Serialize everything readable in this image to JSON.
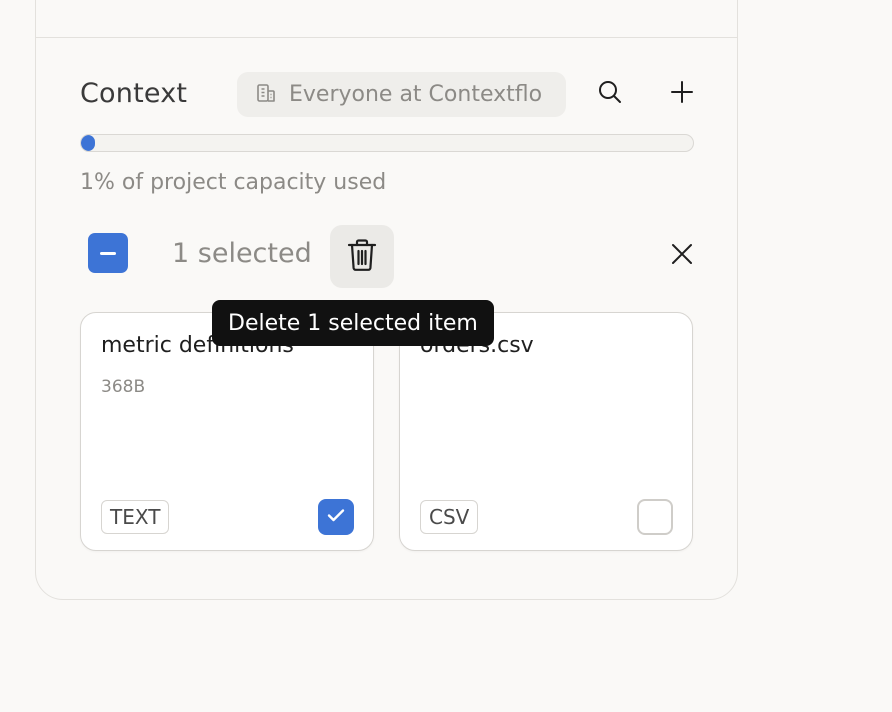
{
  "context": {
    "title": "Context",
    "scope_label": "Everyone at Contextflo",
    "capacity_percent": 1,
    "capacity_text": "1% of project capacity used"
  },
  "selection": {
    "count_text": "1 selected",
    "delete_tooltip": "Delete 1 selected item"
  },
  "items": [
    {
      "name": "metric definitions",
      "size": "368B",
      "type": "TEXT",
      "checked": true
    },
    {
      "name": "orders.csv",
      "size": "",
      "type": "CSV",
      "checked": false
    }
  ],
  "icons": {
    "scope": "building-icon",
    "search": "search-icon",
    "add": "plus-icon",
    "select_all": "minus-icon",
    "delete": "trash-icon",
    "clear": "close-icon",
    "checked": "check-icon"
  },
  "colors": {
    "accent": "#3d74d6",
    "muted_text": "#8c8a86",
    "tooltip_bg": "#111111"
  }
}
